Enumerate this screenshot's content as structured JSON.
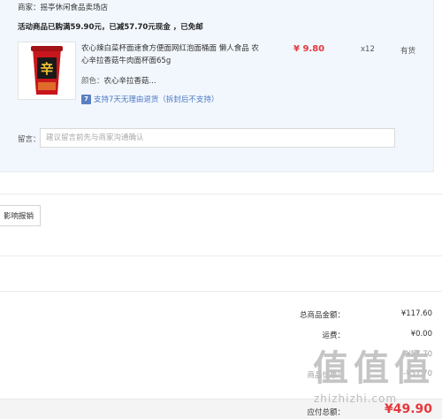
{
  "shop": {
    "label": "商家：",
    "name": "摇亭休闲食品卖场店"
  },
  "promo": {
    "text": "活动商品已购满59.90元，已减57.70元现金 ，已免邮"
  },
  "product": {
    "thumb_icon": "instant-noodle-cup-image",
    "cup_text": "辛",
    "title": "农心辣白菜杯面速食方便面网红泡面桶面 懒人食品 农心辛拉香菇牛肉面杯面65g",
    "price": "¥ 9.80",
    "qty": "x12",
    "stock": "有货",
    "color_label": "颜色：",
    "color_value": "农心辛拉香菇...",
    "service_icon_text": "7",
    "service_text": "支持7天无理由退货（拆封后不支持）"
  },
  "note": {
    "label": "留言：",
    "placeholder": "建议留言前先与商家沟通确认"
  },
  "invoice": {
    "button_label": "影响报销"
  },
  "summary": [
    {
      "label": "总商品金额：",
      "value": "¥117.60"
    },
    {
      "label": "运费：",
      "value": "¥0.00"
    },
    {
      "label": "",
      "value": "-¥57.70"
    },
    {
      "label": "商品优惠：",
      "value": "-¥57.70"
    }
  ],
  "payment": {
    "label": "应付总额：",
    "amount": "¥49.90"
  },
  "watermark": {
    "glyphs": [
      "值",
      "值",
      "值"
    ],
    "text": "zhizhizhi.com"
  },
  "colors": {
    "price_red": "#e4393c",
    "panel_bg": "#f2f7fd",
    "link_blue": "#4a78c4"
  }
}
